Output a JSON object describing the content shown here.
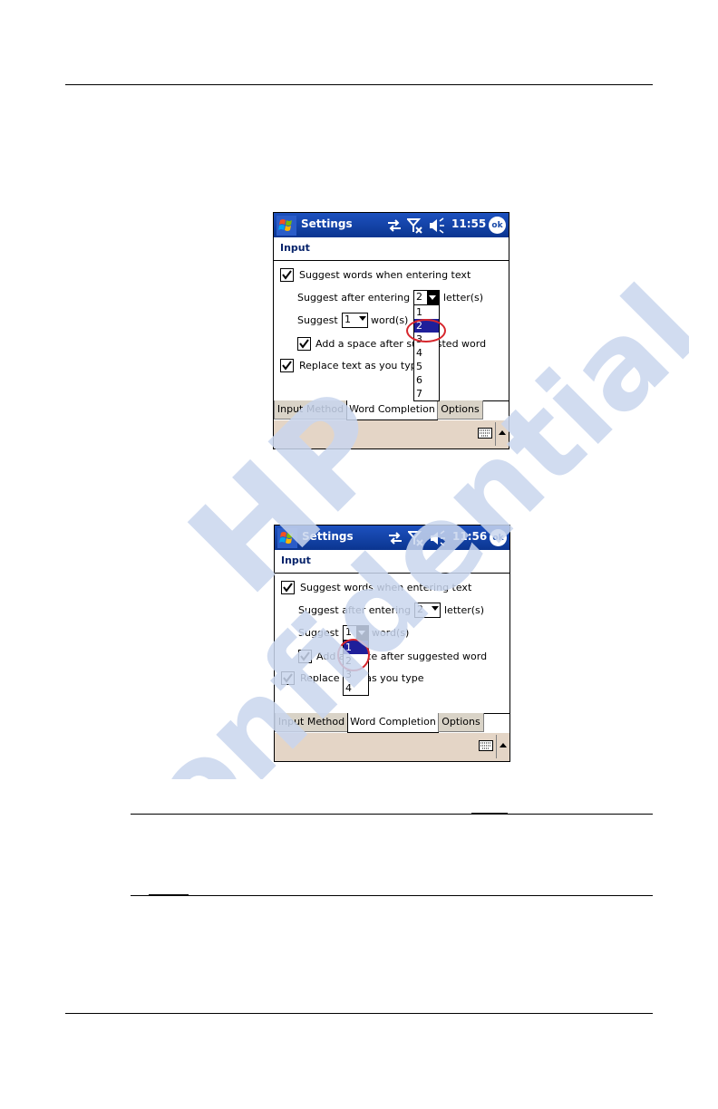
{
  "screens": [
    {
      "title": "Settings",
      "clock": "11:55",
      "ok_label": "ok",
      "heading": "Input",
      "suggest_words_label": "Suggest words when entering text",
      "suggest_after_label": "Suggest after entering",
      "letters_value": "2",
      "letters_unit": "letter(s)",
      "suggest_label": "Suggest",
      "words_value": "1",
      "words_unit": "word(s)",
      "add_space_label": "Add a space after suggested word",
      "replace_text_label": "Replace text as you type",
      "dropdown_options": [
        "1",
        "2",
        "3",
        "4",
        "5",
        "6",
        "7"
      ],
      "dropdown_selected": "2",
      "tabs": [
        "Input Method",
        "Word Completion",
        "Options"
      ]
    },
    {
      "title": "Settings",
      "clock": "11:56",
      "ok_label": "ok",
      "heading": "Input",
      "suggest_words_label": "Suggest words when entering text",
      "suggest_after_label": "Suggest after entering",
      "letters_value": "2",
      "letters_unit": "letter(s)",
      "suggest_label": "Suggest",
      "words_value": "1",
      "words_unit": "word(s)",
      "add_space_label": "Add a space after suggested word",
      "replace_text_label": "Replace text as you type",
      "dropdown_options": [
        "1",
        "2",
        "3",
        "4"
      ],
      "dropdown_selected": "1",
      "tabs": [
        "Input Method",
        "Word Completion",
        "Options"
      ]
    }
  ],
  "watermark": {
    "line1": "HP",
    "line2": "Confidential"
  },
  "colors": {
    "titlebar": "#0b3590",
    "highlight": "#1f1f9a",
    "circle": "#d6262c",
    "watermark": "#c9d6ee"
  }
}
